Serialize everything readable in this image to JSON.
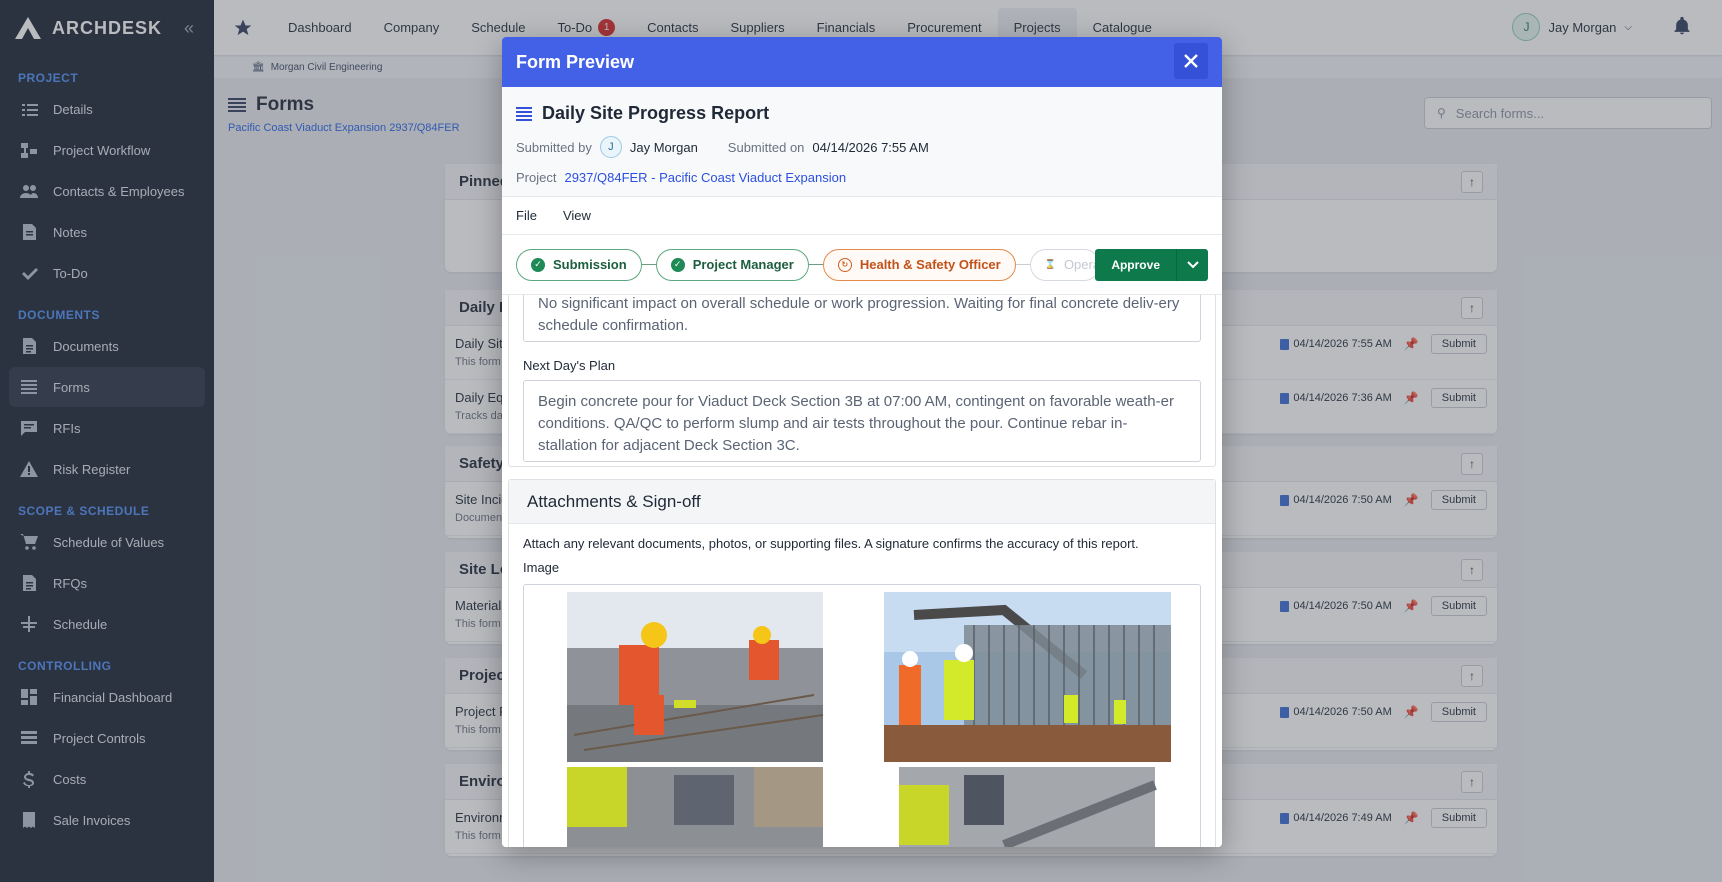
{
  "brand": {
    "name": "ARCHDESK"
  },
  "sidebar": {
    "sections": [
      {
        "title": "PROJECT",
        "items": [
          {
            "label": "Details",
            "icon": "list-icon"
          },
          {
            "label": "Project Workflow",
            "icon": "workflow-icon"
          },
          {
            "label": "Contacts & Employees",
            "icon": "people-icon"
          },
          {
            "label": "Notes",
            "icon": "note-icon"
          },
          {
            "label": "To-Do",
            "icon": "check-icon"
          }
        ]
      },
      {
        "title": "DOCUMENTS",
        "items": [
          {
            "label": "Documents",
            "icon": "document-icon"
          },
          {
            "label": "Forms",
            "icon": "forms-icon"
          },
          {
            "label": "RFIs",
            "icon": "chat-icon"
          },
          {
            "label": "Risk Register",
            "icon": "warning-icon"
          }
        ]
      },
      {
        "title": "SCOPE & SCHEDULE",
        "items": [
          {
            "label": "Schedule of Values",
            "icon": "cart-icon"
          },
          {
            "label": "RFQs",
            "icon": "document-icon"
          },
          {
            "label": "Schedule",
            "icon": "schedule-icon"
          }
        ]
      },
      {
        "title": "CONTROLLING",
        "items": [
          {
            "label": "Financial Dashboard",
            "icon": "dashboard-icon"
          },
          {
            "label": "Project Controls",
            "icon": "table-icon"
          },
          {
            "label": "Costs",
            "icon": "dollar-icon"
          },
          {
            "label": "Sale Invoices",
            "icon": "invoice-icon"
          }
        ]
      }
    ]
  },
  "topnav": {
    "items": [
      "Dashboard",
      "Company",
      "Schedule",
      "To-Do",
      "Contacts",
      "Suppliers",
      "Financials",
      "Procurement",
      "Projects",
      "Catalogue"
    ],
    "todo_badge": "1",
    "active": "Projects"
  },
  "user": {
    "initial": "J",
    "name": "Jay Morgan"
  },
  "subbar": {
    "company": "Morgan Civil Engineering"
  },
  "page": {
    "title": "Forms",
    "subtitle": "Pacific Coast Viaduct Expansion 2937/Q84FER",
    "search_placeholder": "Search forms..."
  },
  "cards": [
    {
      "title": "Pinned",
      "rows": []
    },
    {
      "title": "Daily Progress",
      "rows": [
        {
          "name": "Daily Site Progress Report",
          "desc": "This form is used to record daily site progress, weather conditions, observations, and any encountered issues.",
          "date": "04/14/2026 7:55 AM"
        },
        {
          "name": "Daily Equipment Log",
          "desc": "Tracks daily equipment usage and condition.",
          "date": "04/14/2026 7:36 AM"
        }
      ]
    },
    {
      "title": "Safety",
      "rows": [
        {
          "name": "Site Incident Report",
          "desc": "Document site incidents, near misses, and corrective action.",
          "date": "04/14/2026 7:50 AM"
        }
      ]
    },
    {
      "title": "Site Logistics",
      "rows": [
        {
          "name": "Material Delivery Log",
          "desc": "This form logs material deliveries against specifications.",
          "date": "04/14/2026 7:50 AM"
        }
      ]
    },
    {
      "title": "Project Reviews",
      "rows": [
        {
          "name": "Project Review",
          "desc": "This form records project review meetings.",
          "date": "04/14/2026 7:50 AM"
        }
      ]
    },
    {
      "title": "Environmental",
      "rows": [
        {
          "name": "Environmental Monitoring",
          "desc": "This form monitors environmental impact on nearby waterways or coastal marshlands.",
          "date": "04/14/2026 7:49 AM"
        }
      ]
    }
  ],
  "card_labels": {
    "submit": "Submit"
  },
  "modal": {
    "title": "Form Preview",
    "form_title": "Daily Site Progress Report",
    "submitted_by_label": "Submitted by",
    "submitted_by_initial": "J",
    "submitted_by": "Jay Morgan",
    "submitted_on_label": "Submitted on",
    "submitted_on": "04/14/2026 7:55 AM",
    "project_label": "Project",
    "project_link": "2937/Q84FER - Pacific Coast Viaduct Expansion",
    "menu": [
      "File",
      "View"
    ],
    "steps": [
      {
        "label": "Submission",
        "state": "done"
      },
      {
        "label": "Project Manager",
        "state": "done"
      },
      {
        "label": "Health & Safety Officer",
        "state": "current"
      },
      {
        "label": "Operations",
        "state": "pending"
      }
    ],
    "approve_label": "Approve",
    "prev_text": "No significant impact on overall schedule or work progression. Waiting for final concrete deliv-ery schedule confirmation.",
    "next_plan_label": "Next Day's Plan",
    "next_plan_text": "Begin concrete pour for Viaduct Deck Section 3B at 07:00 AM, contingent on favorable weath-er conditions. QA/QC to perform slump and air tests throughout the pour. Continue rebar in-stallation for adjacent Deck Section 3C.",
    "attachments_title": "Attachments & Sign-off",
    "attachments_desc": "Attach any relevant documents, photos, or supporting files. A signature confirms the accuracy of this report.",
    "image_label": "Image"
  }
}
